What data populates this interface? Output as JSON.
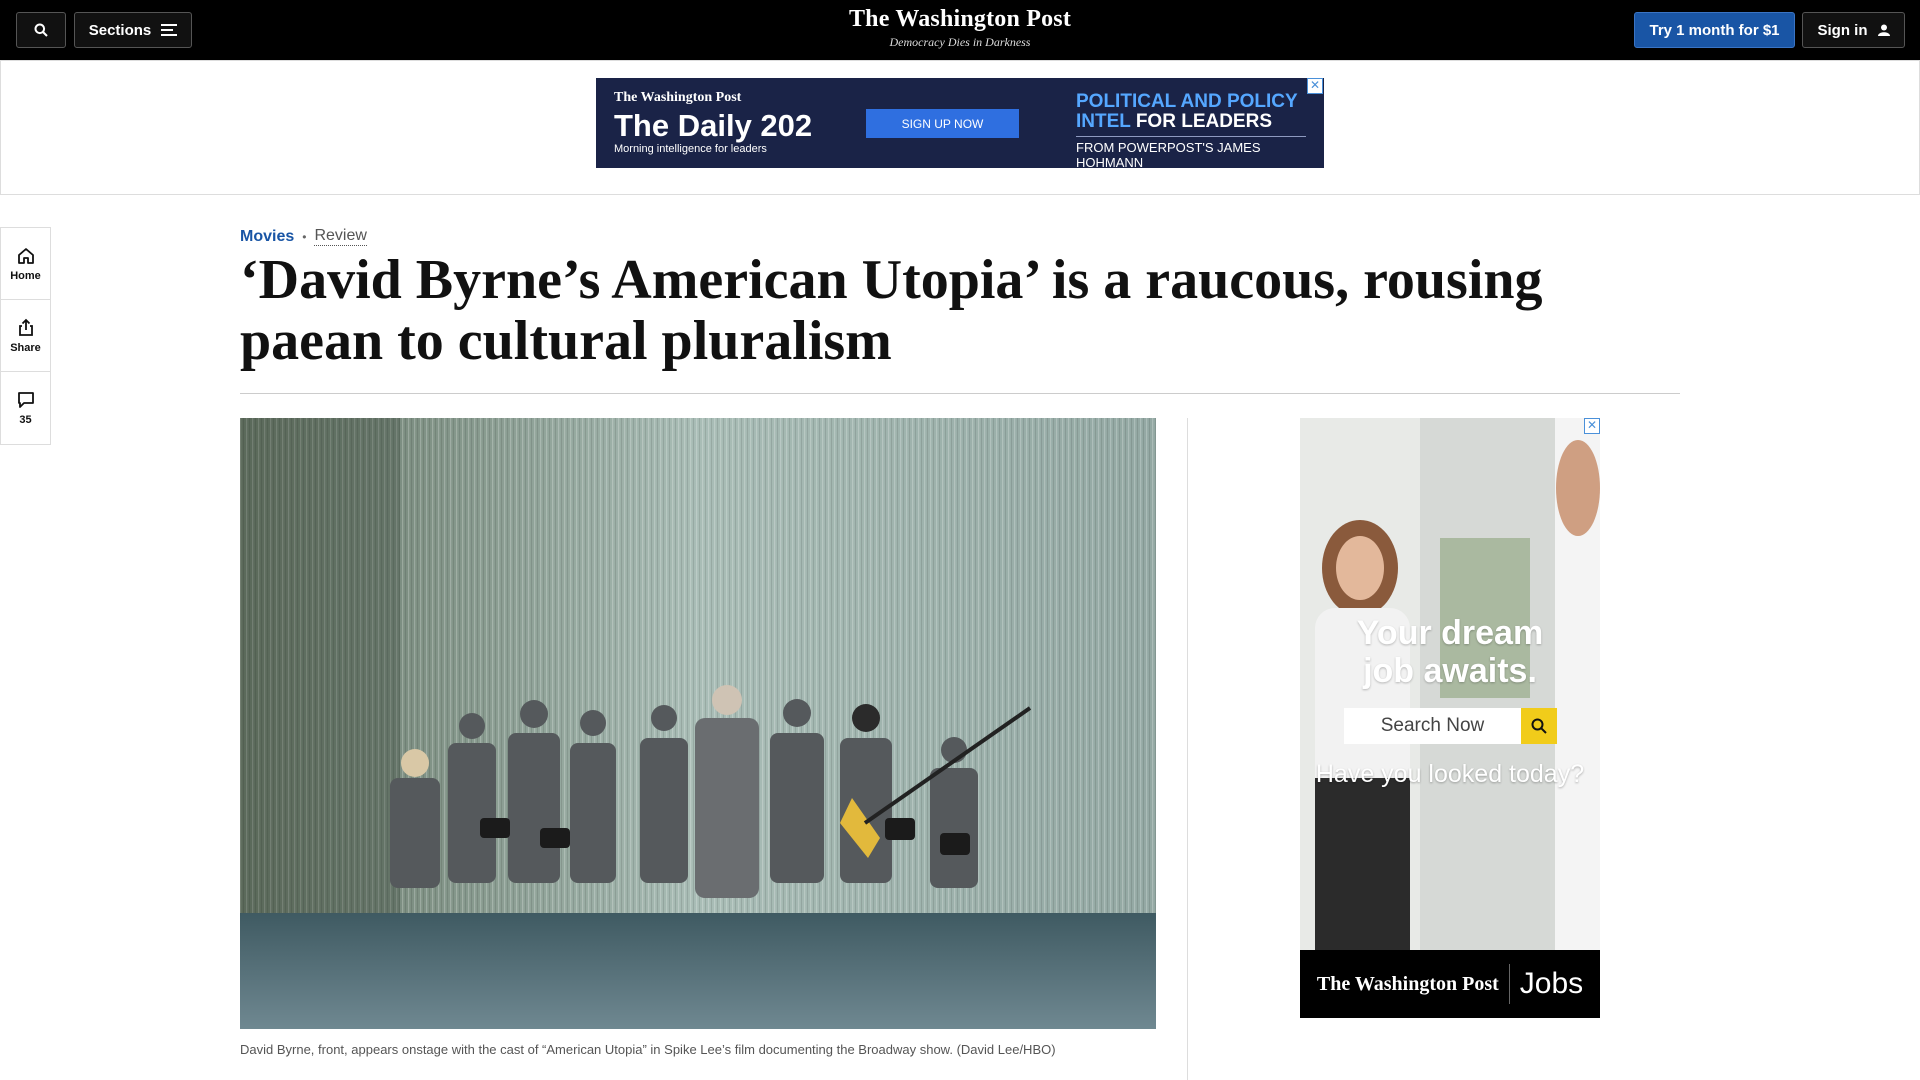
{
  "header": {
    "sections_label": "Sections",
    "logo": "The Washington Post",
    "tagline": "Democracy Dies in Darkness",
    "trial_label": "Try 1 month for $1",
    "signin_label": "Sign in"
  },
  "top_ad": {
    "logo": "The Washington Post",
    "title": "The Daily 202",
    "subtitle": "Morning intelligence for leaders",
    "cta": "SIGN UP NOW",
    "headline_blue": "POLITICAL AND POLICY INTEL",
    "headline_white": "FOR LEADERS",
    "byline": "FROM POWERPOST'S JAMES HOHMANN",
    "close": "✕"
  },
  "rail": {
    "home": "Home",
    "share": "Share",
    "comments_count": "35"
  },
  "article": {
    "section": "Movies",
    "label": "Review",
    "headline": "‘David Byrne’s American Utopia’ is a raucous, rousing paean to cultural pluralism",
    "caption": "David Byrne, front, appears onstage with the cast of “American Utopia” in Spike Lee’s film documenting the Broadway show. (David Lee/HBO)"
  },
  "side_ad": {
    "line1": "Your dream",
    "line2": "job awaits.",
    "search_placeholder": "Search Now",
    "question": "Have you looked today?",
    "brand": "The Washington Post",
    "product": "Jobs",
    "close": "✕"
  }
}
